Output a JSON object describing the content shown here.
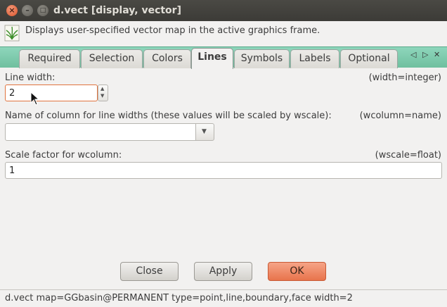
{
  "window": {
    "title": "d.vect [display, vector]"
  },
  "description": "Displays user-specified vector map in the active graphics frame.",
  "tabs": [
    {
      "label": "Required"
    },
    {
      "label": "Selection"
    },
    {
      "label": "Colors"
    },
    {
      "label": "Lines",
      "active": true
    },
    {
      "label": "Symbols"
    },
    {
      "label": "Labels"
    },
    {
      "label": "Optional"
    }
  ],
  "tab_nav": {
    "prev": "◁",
    "next": "▷",
    "close": "✕"
  },
  "form": {
    "line_width": {
      "label": "Line width:",
      "key": "(width=integer)",
      "value": "2"
    },
    "wcolumn": {
      "label": "Name of column for line widths (these values will be scaled by wscale):",
      "key": "(wcolumn=name)",
      "value": ""
    },
    "wscale": {
      "label": "Scale factor for wcolumn:",
      "key": "(wscale=float)",
      "value": "1"
    }
  },
  "buttons": {
    "close": "Close",
    "apply": "Apply",
    "ok": "OK"
  },
  "status": "d.vect map=GGbasin@PERMANENT type=point,line,boundary,face width=2",
  "colors": {
    "accent_tab": "#7fcbb0",
    "ok_button": "#ed7f57",
    "title_bar": "#3c3b37"
  },
  "icons": [
    "close-icon",
    "minimize-icon",
    "maximize-icon",
    "grass-logo-icon",
    "spin-up-icon",
    "spin-down-icon",
    "chevron-down-icon",
    "mouse-cursor-icon"
  ]
}
